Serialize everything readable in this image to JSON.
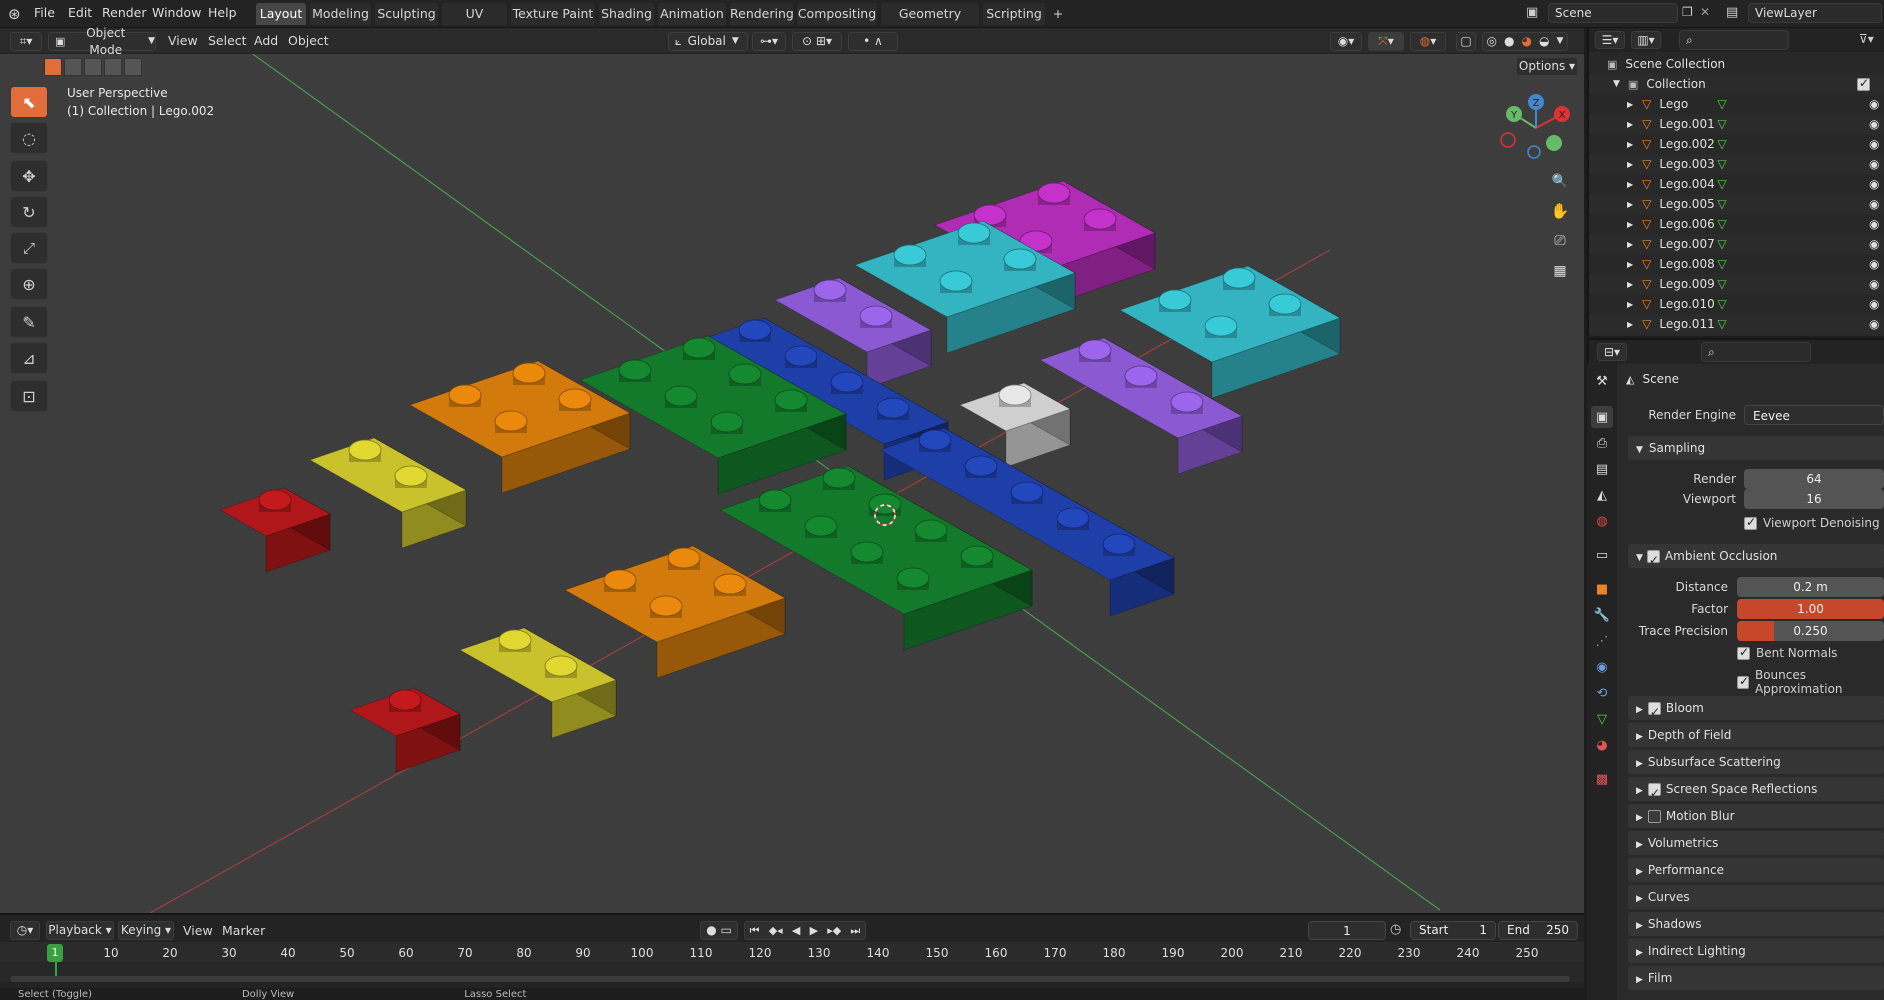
{
  "topbar": {
    "menus": [
      "File",
      "Edit",
      "Render",
      "Window",
      "Help"
    ],
    "workspaces": [
      "Layout",
      "Modeling",
      "Sculpting",
      "UV Editing",
      "Texture Paint",
      "Shading",
      "Animation",
      "Rendering",
      "Compositing",
      "Geometry Nodes",
      "Scripting"
    ],
    "active_workspace": "Layout",
    "add_tab": "+",
    "scene": "Scene",
    "view_layer": "ViewLayer"
  },
  "viewport": {
    "mode": "Object Mode",
    "menus": [
      "View",
      "Select",
      "Add",
      "Object"
    ],
    "transform_orientation": "Global",
    "options_label": "Options",
    "overlay_title": "User Perspective",
    "overlay_subtitle": "(1) Collection | Lego.002",
    "gizmo_axes": [
      "X",
      "Y",
      "Z"
    ]
  },
  "outliner": {
    "search_placeholder": "",
    "root": "Scene Collection",
    "collection": "Collection",
    "items": [
      "Lego",
      "Lego.001",
      "Lego.002",
      "Lego.003",
      "Lego.004",
      "Lego.005",
      "Lego.006",
      "Lego.007",
      "Lego.008",
      "Lego.009",
      "Lego.010",
      "Lego.011"
    ]
  },
  "properties": {
    "context": "Scene",
    "render_engine_label": "Render Engine",
    "render_engine": "Eevee",
    "sampling": {
      "title": "Sampling",
      "render_label": "Render",
      "render_value": "64",
      "viewport_label": "Viewport",
      "viewport_value": "16",
      "denoise_label": "Viewport Denoising"
    },
    "ao": {
      "title": "Ambient Occlusion",
      "distance_label": "Distance",
      "distance_value": "0.2 m",
      "factor_label": "Factor",
      "factor_value": "1.00",
      "precision_label": "Trace Precision",
      "precision_value": "0.250",
      "bent_label": "Bent Normals",
      "bounces_label": "Bounces Approximation"
    },
    "sections": [
      {
        "label": "Bloom",
        "checkbox": true,
        "checked": true
      },
      {
        "label": "Depth of Field",
        "checkbox": false
      },
      {
        "label": "Subsurface Scattering",
        "checkbox": false
      },
      {
        "label": "Screen Space Reflections",
        "checkbox": true,
        "checked": true
      },
      {
        "label": "Motion Blur",
        "checkbox": true,
        "checked": false
      },
      {
        "label": "Volumetrics",
        "checkbox": false
      },
      {
        "label": "Performance",
        "checkbox": false
      },
      {
        "label": "Curves",
        "checkbox": false
      },
      {
        "label": "Shadows",
        "checkbox": false
      },
      {
        "label": "Indirect Lighting",
        "checkbox": false
      },
      {
        "label": "Film",
        "checkbox": false
      }
    ]
  },
  "timeline": {
    "menus": [
      "Playback",
      "Keying",
      "View",
      "Marker"
    ],
    "current_frame": "1",
    "start_label": "Start",
    "start_value": "1",
    "end_label": "End",
    "end_value": "250",
    "playhead": "1",
    "ticks": [
      "10",
      "20",
      "30",
      "40",
      "50",
      "60",
      "70",
      "80",
      "90",
      "100",
      "110",
      "120",
      "130",
      "140",
      "150",
      "160",
      "170",
      "180",
      "190",
      "200",
      "210",
      "220",
      "230",
      "240",
      "250"
    ]
  },
  "statusbar": {
    "items": [
      "Select (Toggle)",
      "Dolly View",
      "Lasso Select"
    ]
  },
  "colors": {
    "accent": "#e06d3a",
    "viewport_bg": "#3d3d3d",
    "factor_bar": "#c7472a",
    "red": "#b0171a",
    "yellow": "#c9c22c",
    "orange": "#d27a0c",
    "green": "#137a2b",
    "blue": "#1f3fa8",
    "purple": "#8b5ad2",
    "cyan": "#33b4c0",
    "magenta": "#b02cb5",
    "white": "#cfcfcf"
  }
}
